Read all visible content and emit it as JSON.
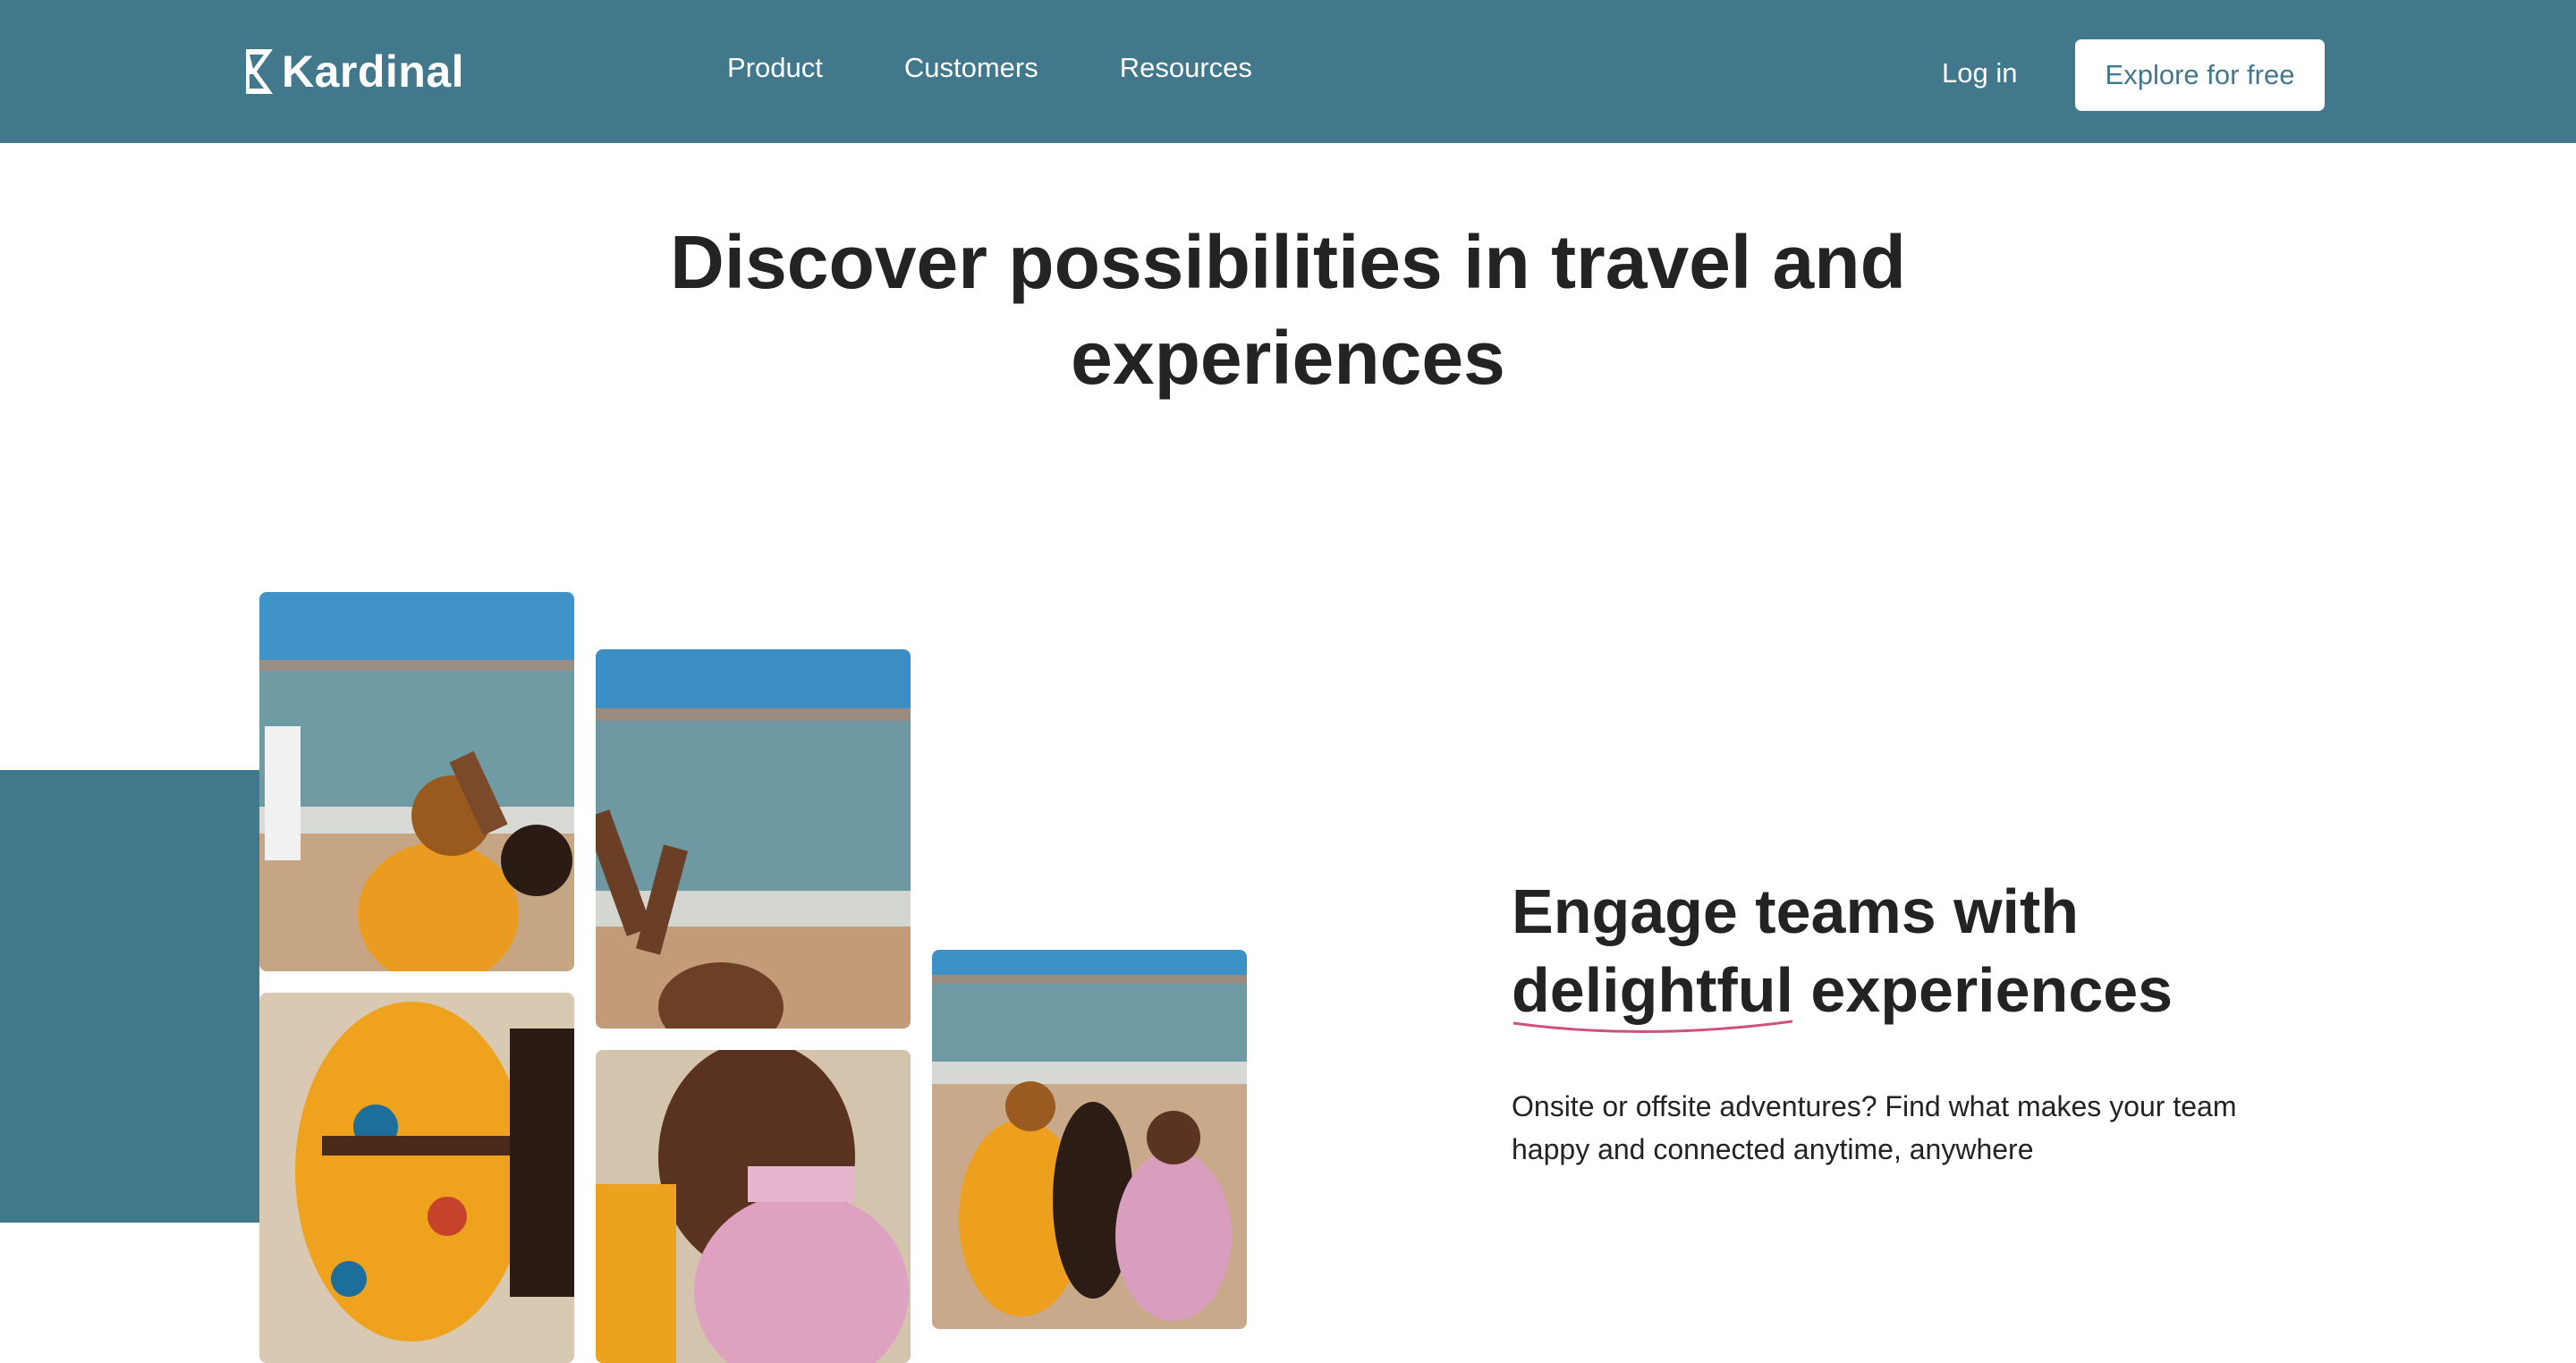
{
  "brand": {
    "name": "Kardinal",
    "color": "#42788b"
  },
  "nav": {
    "items": [
      {
        "label": "Product"
      },
      {
        "label": "Customers"
      },
      {
        "label": "Resources"
      }
    ],
    "login_label": "Log in",
    "cta_label": "Explore for free"
  },
  "hero": {
    "title": "Discover possibilities in travel and experiences"
  },
  "gallery": {
    "photos": [
      "beach-photo-top-left",
      "beach-photo-top-middle",
      "beach-photo-bottom-left",
      "beach-photo-bottom-middle",
      "beach-photo-right"
    ]
  },
  "feature": {
    "title_line1": "Engage teams with",
    "title_highlight": "delightful",
    "title_rest": "experiences",
    "subtitle": "Onsite or offsite adventures? Find what makes your team happy and connected anytime, anywhere",
    "underline_color": "#d1517e"
  }
}
